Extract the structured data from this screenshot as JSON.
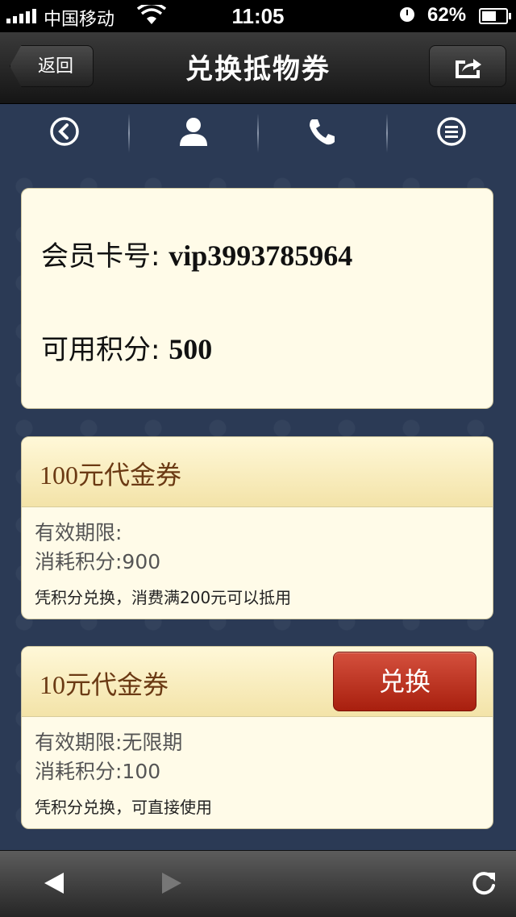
{
  "status_bar": {
    "carrier": "中国移动",
    "time": "11:05",
    "battery_percent": "62%",
    "battery_level": 0.62
  },
  "navbar": {
    "back_label": "返回",
    "title": "兑换抵物券",
    "share_icon": "share-icon"
  },
  "iconbar": {
    "items": [
      "back-circle-icon",
      "user-icon",
      "phone-icon",
      "menu-circle-icon"
    ]
  },
  "member": {
    "card_label": "会员卡号:",
    "card_number": "vip3993785964",
    "points_label": "可用积分:",
    "points": "500"
  },
  "coupons": [
    {
      "title": "100元代金券",
      "validity": "有效期限:",
      "cost": "消耗积分:900",
      "description": "凭积分兑换，消费满200元可以抵用",
      "button": ""
    },
    {
      "title": "10元代金券",
      "validity": "有效期限:无限期",
      "cost": "消耗积分:100",
      "description": "凭积分兑换，可直接使用",
      "button": "兑换"
    }
  ],
  "toolbar": {
    "items": [
      "browser-back-icon",
      "browser-forward-icon",
      "refresh-icon"
    ]
  }
}
